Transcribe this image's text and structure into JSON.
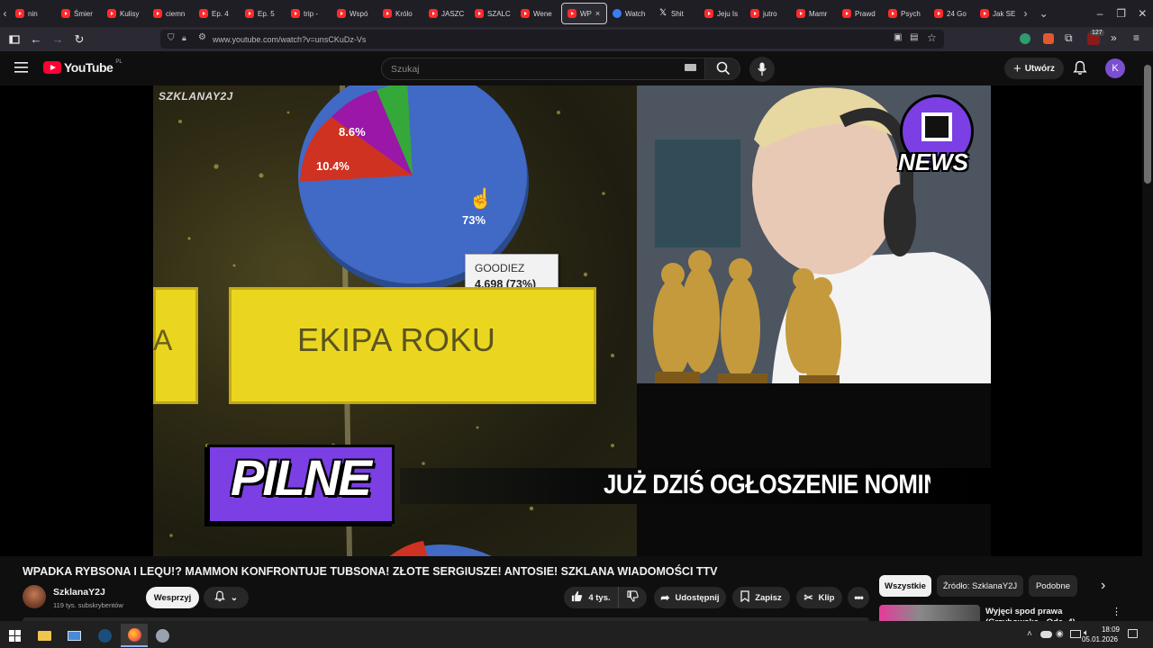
{
  "browser": {
    "tabs": [
      {
        "label": "nin",
        "icon": "youtube-icon"
      },
      {
        "label": "Śmier",
        "icon": "youtube-icon"
      },
      {
        "label": "Kulisy",
        "icon": "youtube-icon"
      },
      {
        "label": "ciemn",
        "icon": "youtube-icon"
      },
      {
        "label": "Ep. 4",
        "icon": "youtube-icon"
      },
      {
        "label": "Ep. 5",
        "icon": "youtube-icon"
      },
      {
        "label": "trip -",
        "icon": "youtube-icon"
      },
      {
        "label": "Wspó",
        "icon": "youtube-icon"
      },
      {
        "label": "Królo",
        "icon": "youtube-icon"
      },
      {
        "label": "JASZC",
        "icon": "youtube-icon"
      },
      {
        "label": "SZALC",
        "icon": "youtube-icon"
      },
      {
        "label": "Wene",
        "icon": "youtube-icon"
      },
      {
        "label": "WP",
        "icon": "youtube-icon",
        "active": true
      },
      {
        "label": "Watch",
        "icon": "watch-icon"
      },
      {
        "label": "Shit",
        "icon": "x-icon"
      },
      {
        "label": "Jeju Is",
        "icon": "youtube-icon"
      },
      {
        "label": "jutro",
        "icon": "youtube-icon"
      },
      {
        "label": "Mamr",
        "icon": "youtube-icon"
      },
      {
        "label": "Prawd",
        "icon": "youtube-icon"
      },
      {
        "label": "Psych",
        "icon": "youtube-icon"
      },
      {
        "label": "24 Go",
        "icon": "youtube-icon"
      },
      {
        "label": "Jak SE",
        "icon": "youtube-icon"
      }
    ],
    "url": "www.youtube.com/watch?v=unsCKuDz-Vs",
    "extension_badge": "127"
  },
  "youtube": {
    "logo_text": "YouTube",
    "logo_region": "PL",
    "search_placeholder": "Szukaj",
    "create_label": "Utwórz",
    "avatar_letter": "K"
  },
  "video": {
    "watermark": "SZKLANAY2J",
    "pie_labels": [
      "8.6%",
      "10.4%",
      "73%"
    ],
    "tooltip_name": "GOODIEZ",
    "tooltip_value": "4,698 (73%)",
    "banner_text": "EKIPA ROKU",
    "banner_left_fragment": "A",
    "news_logo_text": "NEWS",
    "pilne_text": "PILNE",
    "ticker_text": "JUŻ DZIŚ OGŁOSZENIE NOMINAC"
  },
  "watch": {
    "title": "WPADKA RYBSONA I LEQU!? MAMMON KONFRONTUJE TUBSONA! ZŁOTE SERGIUSZE! ANTOSIE! SZKLANA WIADOMOŚCI TTV",
    "channel_name": "SzklanaY2J",
    "subscribers": "119 tys. subskrybentów",
    "support_label": "Wesprzyj",
    "likes": "4 tys.",
    "share_label": "Udostępnij",
    "save_label": "Zapisz",
    "clip_label": "Klip"
  },
  "related": {
    "chips": [
      "Wszystkie",
      "Źródło: SzklanaY2J",
      "Podobne"
    ],
    "first_item_title": "Wyjęci spod prawa (Grzybowska - Odc. 4)"
  },
  "taskbar": {
    "time": "18:09",
    "date": "05.01.2026"
  },
  "colors": {
    "youtube_red": "#ff0033",
    "pilne_purple": "#7b3fe4",
    "banner_yellow": "#ebd61f",
    "pie_blue": "#3f6ac9"
  }
}
